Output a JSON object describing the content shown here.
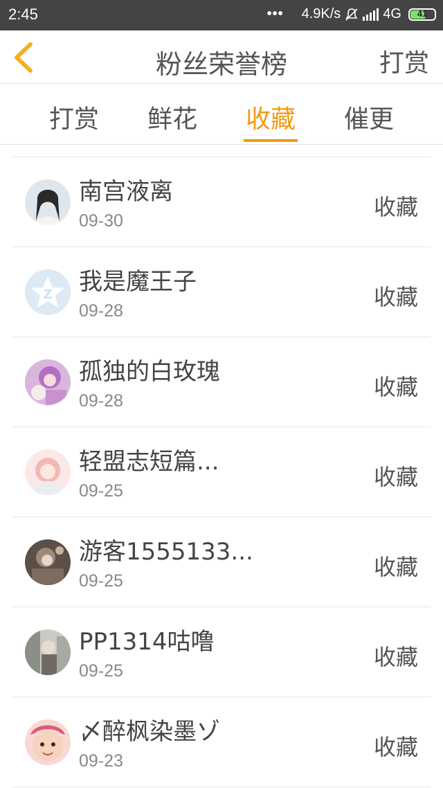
{
  "status_bar": {
    "time": "2:45",
    "dots": "•••",
    "speed": "4.9K/s",
    "network": "4G",
    "battery": "41"
  },
  "header": {
    "title": "粉丝荣誉榜",
    "right_action": "打赏",
    "back_icon": "chevron-left-icon",
    "accent_color": "#f29a12"
  },
  "tabs": [
    {
      "label": "打赏",
      "active": false
    },
    {
      "label": "鲜花",
      "active": false
    },
    {
      "label": "收藏",
      "active": true
    },
    {
      "label": "催更",
      "active": false
    }
  ],
  "list": [
    {
      "name": "南宫液离",
      "date": "09-30",
      "action": "收藏"
    },
    {
      "name": "我是魔王子",
      "date": "09-28",
      "action": "收藏"
    },
    {
      "name": "孤独的白玫瑰",
      "date": "09-28",
      "action": "收藏"
    },
    {
      "name": "轻盟志短篇...",
      "date": "09-25",
      "action": "收藏"
    },
    {
      "name": "游客1555133...",
      "date": "09-25",
      "action": "收藏"
    },
    {
      "name": "PP1314咕噜",
      "date": "09-25",
      "action": "收藏"
    },
    {
      "name": "〆醉枫染墨ゾ",
      "date": "09-23",
      "action": "收藏"
    }
  ]
}
